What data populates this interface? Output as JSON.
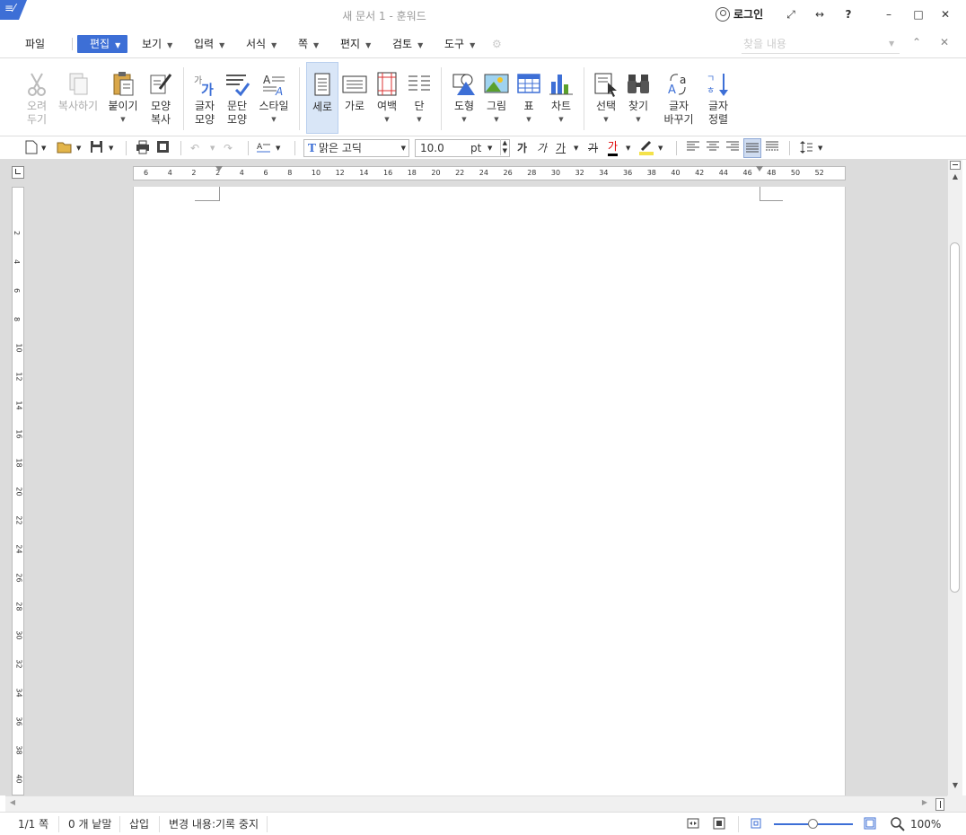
{
  "window": {
    "title": "새 문서 1 - 훈워드",
    "login": "로그인",
    "help": "?"
  },
  "menu": {
    "file": "파일",
    "items": [
      "편집",
      "보기",
      "입력",
      "서식",
      "쪽",
      "편지",
      "검토",
      "도구"
    ],
    "search_placeholder": "찾을 내용"
  },
  "ribbon": {
    "cut": "오려\n두기",
    "copy": "복사하기",
    "paste": "붙이기",
    "format_copy": "모양\n복사",
    "char_shape": "글자\n모양",
    "para_shape": "문단\n모양",
    "style": "스타일",
    "portrait": "세로",
    "landscape": "가로",
    "margin": "여백",
    "column": "단",
    "shape": "도형",
    "picture": "그림",
    "table": "표",
    "chart": "차트",
    "select": "선택",
    "find": "찾기",
    "replace": "글자\n바꾸기",
    "sort": "글자\n정렬"
  },
  "toolbar": {
    "font": "맑은 고딕",
    "font_size": "10.0",
    "size_unit": "pt",
    "bold": "가",
    "italic": "가",
    "underline": "가",
    "strike": "가",
    "font_color": "가"
  },
  "ruler": {
    "h_ticks": [
      "6",
      "4",
      "2",
      "2",
      "4",
      "6",
      "8",
      "10",
      "12",
      "14",
      "16",
      "18",
      "20",
      "22",
      "24",
      "26",
      "28",
      "30",
      "32",
      "34",
      "36",
      "38",
      "40",
      "42",
      "44",
      "46",
      "48",
      "50",
      "52"
    ],
    "v_ticks": [
      "2",
      "4",
      "6",
      "8",
      "10",
      "12",
      "14",
      "16",
      "18",
      "20",
      "22",
      "24",
      "26",
      "28",
      "30",
      "32",
      "34",
      "36",
      "38",
      "40"
    ]
  },
  "status": {
    "page": "1/1 쪽",
    "words": "0 개 낱말",
    "mode": "삽입",
    "track": "변경 내용:기록 중지",
    "zoom": "100%",
    "zoom_level": 0.5
  },
  "colors": {
    "accent": "#3d6fd6"
  }
}
